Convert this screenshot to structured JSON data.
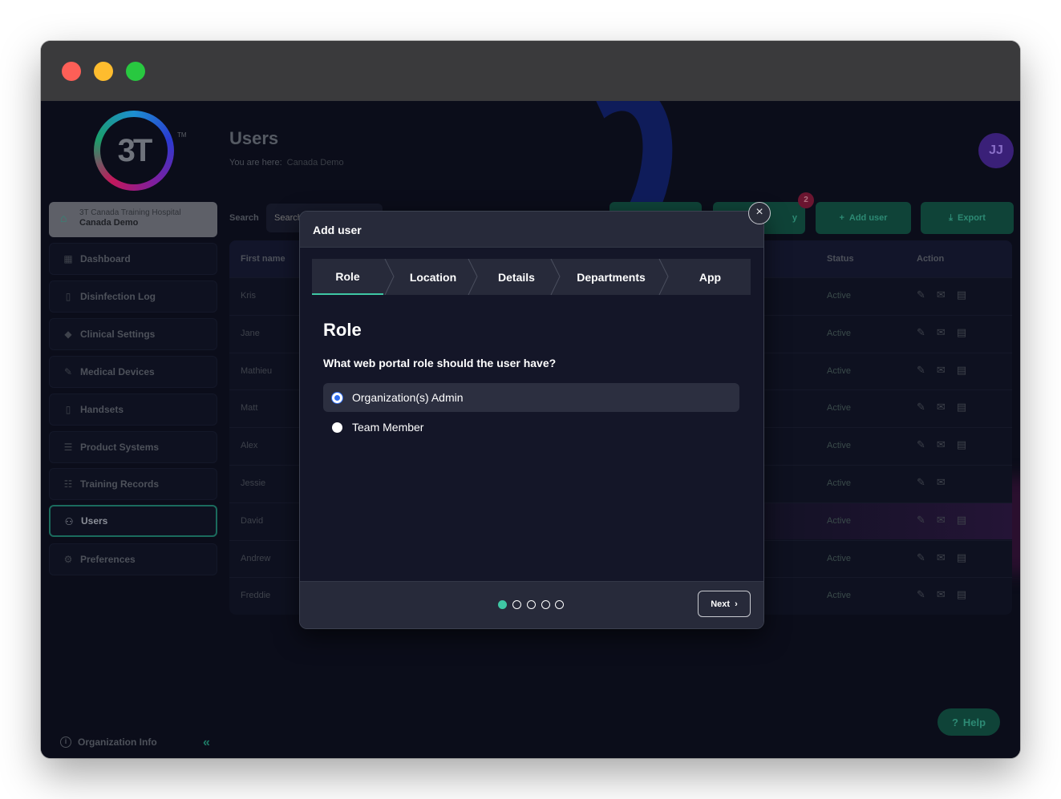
{
  "sidebar": {
    "logo_text": "3T",
    "logo_tm": "TM",
    "org": {
      "hospital": "3T Canada Training Hospital",
      "name": "Canada Demo"
    },
    "items": [
      {
        "label": "Dashboard",
        "icon": "grid-icon"
      },
      {
        "label": "Disinfection Log",
        "icon": "document-icon"
      },
      {
        "label": "Clinical Settings",
        "icon": "diamond-icon"
      },
      {
        "label": "Medical Devices",
        "icon": "pen-icon"
      },
      {
        "label": "Handsets",
        "icon": "phone-icon"
      },
      {
        "label": "Product Systems",
        "icon": "list-icon"
      },
      {
        "label": "Training Records",
        "icon": "checklist-icon"
      },
      {
        "label": "Users",
        "icon": "users-icon",
        "active": true
      },
      {
        "label": "Preferences",
        "icon": "gear-icon"
      }
    ],
    "footer": {
      "label": "Organization Info",
      "collapse": "«"
    }
  },
  "header": {
    "title": "Users",
    "breadcrumb_label": "You are here:",
    "breadcrumb_value": "Canada Demo",
    "avatar": "JJ"
  },
  "toolbar": {
    "search_label": "Search",
    "search_placeholder": "Search",
    "badge_count": "2",
    "add_user": "Add user",
    "export": "Export",
    "partial_button": "y"
  },
  "table": {
    "columns": [
      "First name",
      "Status",
      "Action"
    ],
    "rows": [
      {
        "first": "Kris",
        "status": "Active"
      },
      {
        "first": "Jane",
        "status": "Active"
      },
      {
        "first": "Mathieu",
        "status": "Active"
      },
      {
        "first": "Matt",
        "status": "Active"
      },
      {
        "first": "Alex",
        "status": "Active"
      },
      {
        "first": "Jessie",
        "status": "Active"
      },
      {
        "first": "David",
        "status": "Active"
      },
      {
        "first": "Andrew",
        "status": "Active"
      },
      {
        "first": "Freddie",
        "status": "Active"
      }
    ]
  },
  "help": "Help",
  "modal": {
    "title": "Add user",
    "steps": [
      "Role",
      "Location",
      "Details",
      "Departments",
      "App"
    ],
    "active_step": 0,
    "heading": "Role",
    "question": "What web portal role should the user have?",
    "options": [
      {
        "label": "Organization(s) Admin",
        "selected": true
      },
      {
        "label": "Team Member",
        "selected": false
      }
    ],
    "pagination": {
      "total": 5,
      "current": 1
    },
    "next_label": "Next"
  },
  "colors": {
    "accent": "#3fc7a4",
    "radio_selected": "#2f6df0",
    "modal_header": "#272a3a"
  }
}
